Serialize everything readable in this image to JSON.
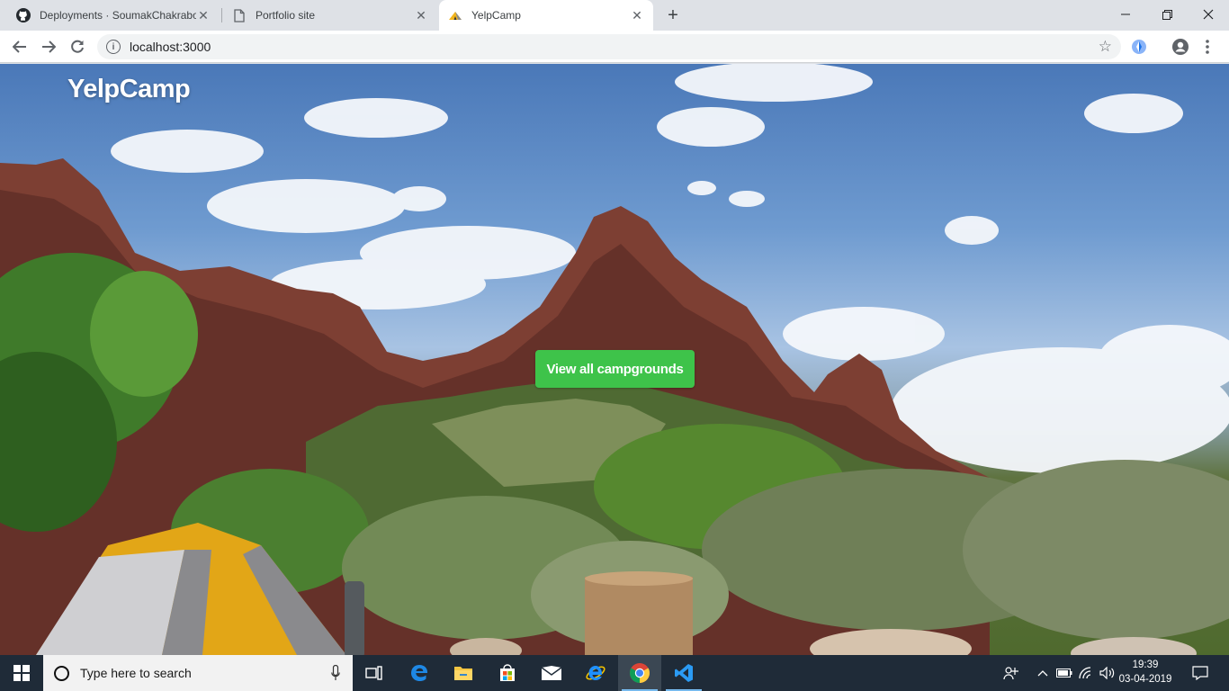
{
  "browser": {
    "tabs": [
      {
        "title": "Deployments · SoumakChakrabo",
        "icon": "github-icon"
      },
      {
        "title": "Portfolio site",
        "icon": "document-icon"
      },
      {
        "title": "YelpCamp",
        "icon": "tent-icon",
        "active": true
      }
    ],
    "url": "localhost:3000"
  },
  "page": {
    "brand": "YelpCamp",
    "cta_label": "View all campgrounds",
    "cta_color": "#3ec34a"
  },
  "taskbar": {
    "search_placeholder": "Type here to search",
    "apps": [
      "task-view-icon",
      "edge-icon",
      "file-explorer-icon",
      "store-icon",
      "mail-icon",
      "internet-explorer-icon",
      "chrome-icon",
      "vscode-icon"
    ],
    "time": "19:39",
    "date": "03-04-2019"
  }
}
